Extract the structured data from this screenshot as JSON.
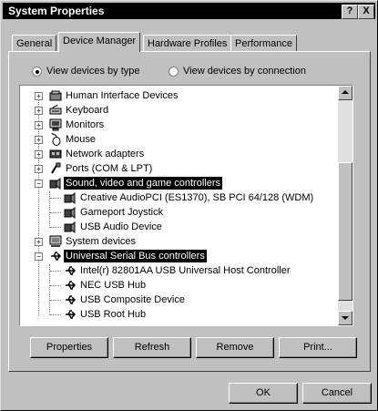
{
  "window": {
    "title": "System Properties",
    "help_label": "?",
    "close_label": "X"
  },
  "tabs": [
    {
      "label": "General"
    },
    {
      "label": "Device Manager"
    },
    {
      "label": "Hardware Profiles"
    },
    {
      "label": "Performance"
    }
  ],
  "view_options": {
    "by_type": "View devices by type",
    "by_connection": "View devices by connection",
    "selected": "by_type"
  },
  "tree": [
    {
      "label": "Human Interface Devices",
      "expander": "+",
      "icon": "hid-icon"
    },
    {
      "label": "Keyboard",
      "expander": "+",
      "icon": "keyboard-icon"
    },
    {
      "label": "Monitors",
      "expander": "+",
      "icon": "monitor-icon"
    },
    {
      "label": "Mouse",
      "expander": "+",
      "icon": "mouse-icon"
    },
    {
      "label": "Network adapters",
      "expander": "+",
      "icon": "network-adapter-icon"
    },
    {
      "label": "Ports (COM & LPT)",
      "expander": "+",
      "icon": "port-icon"
    },
    {
      "label": "Sound, video and game controllers",
      "expander": "−",
      "icon": "sound-icon",
      "selected": true
    },
    {
      "label": "Creative AudioPCI (ES1370), SB PCI 64/128 (WDM)",
      "icon": "sound-device-icon",
      "child": true
    },
    {
      "label": "Gameport Joystick",
      "icon": "sound-device-icon",
      "child": true
    },
    {
      "label": "USB Audio Device",
      "icon": "sound-device-icon",
      "child": true
    },
    {
      "label": "System devices",
      "expander": "+",
      "icon": "system-devices-icon"
    },
    {
      "label": "Universal Serial Bus controllers",
      "expander": "−",
      "icon": "usb-icon",
      "selected": true
    },
    {
      "label": "Intel(r) 82801AA USB Universal Host Controller",
      "icon": "usb-device-icon",
      "child": true
    },
    {
      "label": "NEC USB Hub",
      "icon": "usb-device-icon",
      "child": true
    },
    {
      "label": "USB Composite Device",
      "icon": "usb-device-icon",
      "child": true
    },
    {
      "label": "USB Root Hub",
      "icon": "usb-device-icon",
      "child": true
    }
  ],
  "actions": {
    "properties": "Properties",
    "refresh": "Refresh",
    "remove": "Remove",
    "print": "Print..."
  },
  "dialog": {
    "ok": "OK",
    "cancel": "Cancel"
  }
}
